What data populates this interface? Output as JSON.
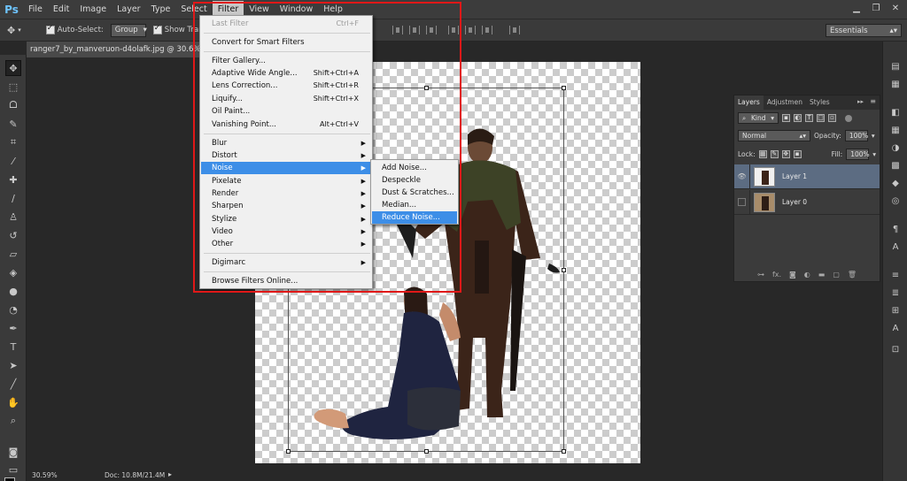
{
  "app": {
    "logo": "Ps"
  },
  "menubar": {
    "items": [
      "File",
      "Edit",
      "Image",
      "Layer",
      "Type",
      "Select",
      "Filter",
      "View",
      "Window",
      "Help"
    ],
    "active_index": 6
  },
  "options_bar": {
    "auto_select_label": "Auto-Select:",
    "auto_select_target": "Group",
    "show_transform_label": "Show Tran",
    "workspace": "Essentials"
  },
  "document": {
    "tab_title": "ranger7_by_manveruon-d4olafk.jpg @ 30.6% (L",
    "zoom": "30.59%",
    "doc_size": "Doc: 10.8M/21.4M"
  },
  "filter_menu": {
    "items": [
      {
        "label": "Last Filter",
        "shortcut": "Ctrl+F",
        "disabled": true
      },
      {
        "separator": true
      },
      {
        "label": "Convert for Smart Filters"
      },
      {
        "separator": true
      },
      {
        "label": "Filter Gallery..."
      },
      {
        "label": "Adaptive Wide Angle...",
        "shortcut": "Shift+Ctrl+A"
      },
      {
        "label": "Lens Correction...",
        "shortcut": "Shift+Ctrl+R"
      },
      {
        "label": "Liquify...",
        "shortcut": "Shift+Ctrl+X"
      },
      {
        "label": "Oil Paint..."
      },
      {
        "label": "Vanishing Point...",
        "shortcut": "Alt+Ctrl+V"
      },
      {
        "separator": true
      },
      {
        "label": "Blur",
        "submenu": true
      },
      {
        "label": "Distort",
        "submenu": true
      },
      {
        "label": "Noise",
        "submenu": true,
        "highlighted": true
      },
      {
        "label": "Pixelate",
        "submenu": true
      },
      {
        "label": "Render",
        "submenu": true
      },
      {
        "label": "Sharpen",
        "submenu": true
      },
      {
        "label": "Stylize",
        "submenu": true
      },
      {
        "label": "Video",
        "submenu": true
      },
      {
        "label": "Other",
        "submenu": true
      },
      {
        "separator": true
      },
      {
        "label": "Digimarc",
        "submenu": true
      },
      {
        "separator": true
      },
      {
        "label": "Browse Filters Online..."
      }
    ]
  },
  "noise_submenu": {
    "items": [
      {
        "label": "Add Noise..."
      },
      {
        "label": "Despeckle"
      },
      {
        "label": "Dust & Scratches..."
      },
      {
        "label": "Median..."
      },
      {
        "label": "Reduce Noise...",
        "highlighted": true
      }
    ]
  },
  "layers_panel": {
    "tabs": [
      "Layers",
      "Adjustmen",
      "Styles"
    ],
    "kind_label": "Kind",
    "blend_mode": "Normal",
    "opacity_label": "Opacity:",
    "opacity_value": "100%",
    "lock_label": "Lock:",
    "fill_label": "Fill:",
    "fill_value": "100%",
    "layers": [
      {
        "name": "Layer 1",
        "visible": true,
        "selected": true
      },
      {
        "name": "Layer 0",
        "visible": false,
        "selected": false
      }
    ]
  },
  "colors": {
    "menu_highlight": "#3d8ee7",
    "annotation_box": "#e01818",
    "selected_layer": "#5c6c82"
  }
}
